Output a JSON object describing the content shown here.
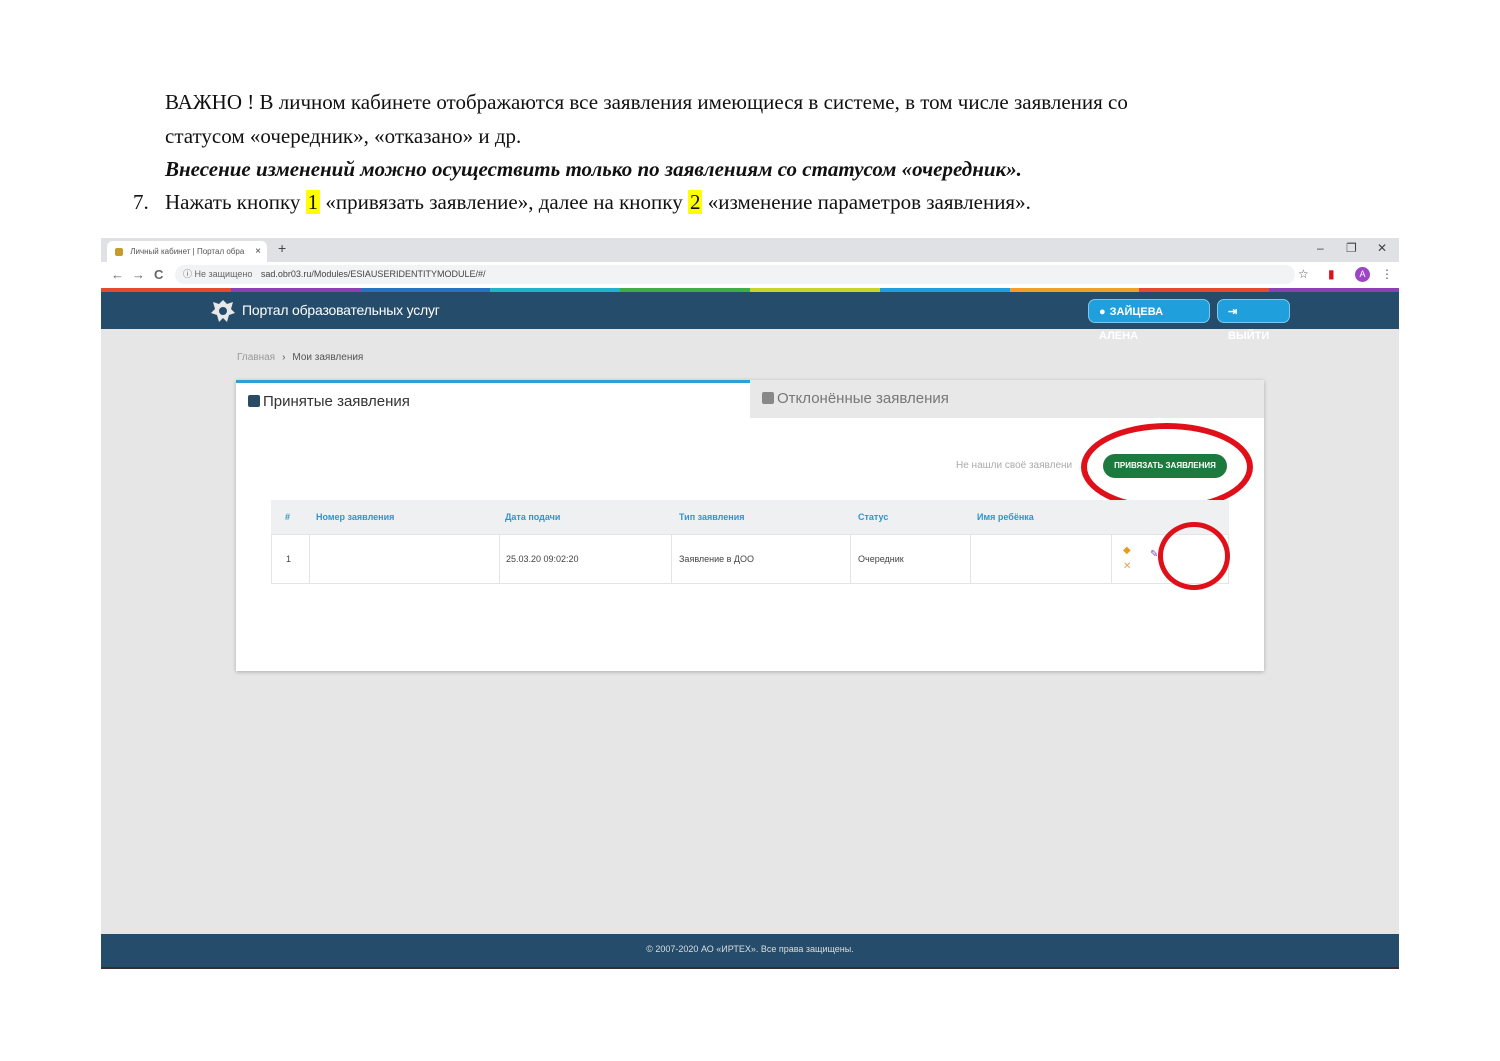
{
  "document": {
    "line1": "ВАЖНО ! В личном кабинете отображаются все заявления имеющиеся в системе, в том числе заявления со",
    "line2": "статусом «очередник», «отказано» и др.",
    "line3": "Внесение изменений можно осуществить только по заявлениям со статусом «очередник».",
    "item_number": "7.",
    "step_part1": "Нажать кнопку ",
    "step_hl1": "1",
    "step_part2": " «привязать заявление», далее на кнопку ",
    "step_hl2": "2",
    "step_part3": " «изменение параметров заявления».",
    "highlight_color": "#ffff00"
  },
  "browser": {
    "tab_title": "Личный кабинет | Портал обра",
    "tab_close": "×",
    "new_tab": "+",
    "minimize": "–",
    "restore": "❐",
    "close": "✕",
    "back": "←",
    "forward": "→",
    "reload": "C",
    "insecure_label": "ⓘ Не защищено",
    "url": "sad.obr03.ru/Modules/ESIAUSERIDENTITYMODULE/#/",
    "star": "☆",
    "menu": "⋮",
    "avatar_letter": "A"
  },
  "portal": {
    "title": "Портал образовательных услуг",
    "user_button": "ЗАЙЦЕВА АЛЕНА",
    "logout_button": "ВЫЙТИ",
    "header_color": "#254c6b",
    "stripe_colors": [
      "#e64a2e",
      "#8e3fb5",
      "#2574c4",
      "#20b3c9",
      "#3fae49",
      "#c8d42b",
      "#1f9fdf",
      "#f0a02a",
      "#e64a2e",
      "#8e3fb5"
    ]
  },
  "breadcrumb": {
    "home": "Главная",
    "separator": "›",
    "current": "Мои заявления"
  },
  "tabs": {
    "accepted": "Принятые заявления",
    "rejected": "Отклонённые заявления"
  },
  "actions": {
    "not_found_text": "Не нашли своё заявлени",
    "attach_button": "ПРИВЯЗАТЬ ЗАЯВЛЕНИЯ"
  },
  "table": {
    "headers": [
      "#",
      "Номер заявления",
      "Дата подачи",
      "Тип заявления",
      "Статус",
      "Имя ребёнка"
    ],
    "rows": [
      {
        "num": "1",
        "number": "",
        "date": "25.03.20 09:02:20",
        "type": "Заявление в ДОО",
        "status": "Очередник",
        "child": ""
      }
    ],
    "edit_icon": "pencil-icon",
    "accent_color": "#2f95cd"
  },
  "footer": {
    "copyright": "© 2007-2020 АО «ИРТЕХ». Все права защищены."
  },
  "annotation_color": "#e0101a"
}
